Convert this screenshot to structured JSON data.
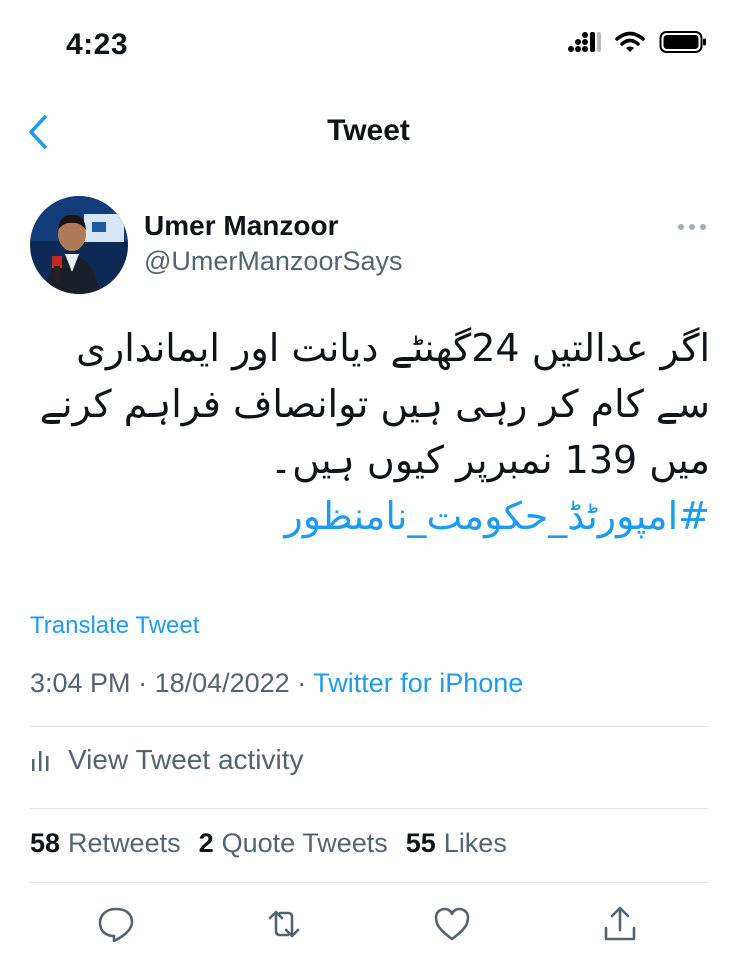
{
  "status_bar": {
    "time": "4:23"
  },
  "header": {
    "title": "Tweet"
  },
  "author": {
    "name": "Umer Manzoor",
    "handle": "@UmerManzoorSays"
  },
  "tweet": {
    "text": "اگر عدالتیں 24گھنٹے دیانت اور ایمانداری سے کام کر رہی ہیں توانصاف فراہم کرنے میں 139 نمبرپر کیوں ہیں۔",
    "hashtag": "#امپورٹڈ_حکومت_نامنظور"
  },
  "translate_label": "Translate Tweet",
  "meta": {
    "time": "3:04 PM",
    "sep1": " · ",
    "date": "18/04/2022",
    "sep2": " · ",
    "source": "Twitter for iPhone"
  },
  "activity_label": "View Tweet activity",
  "stats": {
    "retweets_count": "58",
    "retweets_label": "Retweets",
    "quotes_count": "2",
    "quotes_label": "Quote Tweets",
    "likes_count": "55",
    "likes_label": "Likes"
  },
  "icons": [
    "signal-icon",
    "wifi-icon",
    "battery-icon",
    "back-chevron-icon",
    "more-icon",
    "activity-icon",
    "reply-icon",
    "retweet-icon",
    "like-icon",
    "share-icon"
  ],
  "colors": {
    "accent": "#1d9bf0",
    "secondary_text": "#536471",
    "divider": "#e1e5e8"
  }
}
